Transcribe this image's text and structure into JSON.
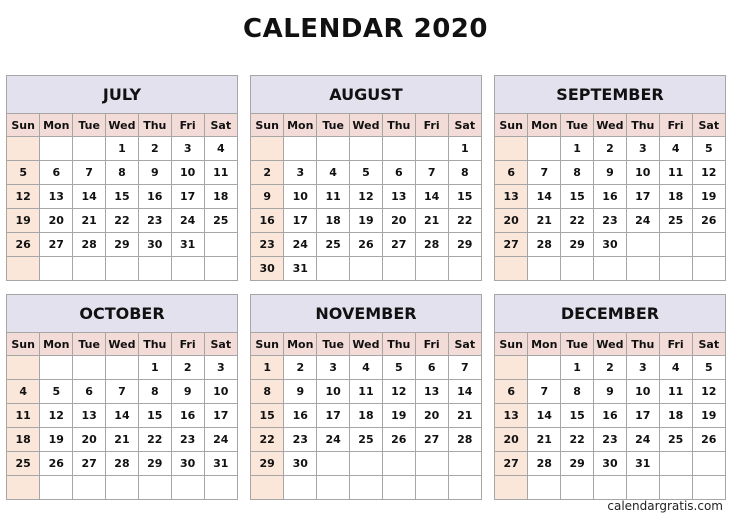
{
  "title": "CALENDAR 2020",
  "weekdays": [
    "Sun",
    "Mon",
    "Tue",
    "Wed",
    "Thu",
    "Fri",
    "Sat"
  ],
  "months": [
    {
      "name": "JULY",
      "weeks": [
        [
          "",
          "",
          "",
          "1",
          "2",
          "3",
          "4"
        ],
        [
          "5",
          "6",
          "7",
          "8",
          "9",
          "10",
          "11"
        ],
        [
          "12",
          "13",
          "14",
          "15",
          "16",
          "17",
          "18"
        ],
        [
          "19",
          "20",
          "21",
          "22",
          "23",
          "24",
          "25"
        ],
        [
          "26",
          "27",
          "28",
          "29",
          "30",
          "31",
          ""
        ],
        [
          "",
          "",
          "",
          "",
          "",
          "",
          ""
        ]
      ]
    },
    {
      "name": "AUGUST",
      "weeks": [
        [
          "",
          "",
          "",
          "",
          "",
          "",
          "1"
        ],
        [
          "2",
          "3",
          "4",
          "5",
          "6",
          "7",
          "8"
        ],
        [
          "9",
          "10",
          "11",
          "12",
          "13",
          "14",
          "15"
        ],
        [
          "16",
          "17",
          "18",
          "19",
          "20",
          "21",
          "22"
        ],
        [
          "23",
          "24",
          "25",
          "26",
          "27",
          "28",
          "29"
        ],
        [
          "30",
          "31",
          "",
          "",
          "",
          "",
          ""
        ]
      ]
    },
    {
      "name": "SEPTEMBER",
      "weeks": [
        [
          "",
          "",
          "1",
          "2",
          "3",
          "4",
          "5"
        ],
        [
          "6",
          "7",
          "8",
          "9",
          "10",
          "11",
          "12"
        ],
        [
          "13",
          "14",
          "15",
          "16",
          "17",
          "18",
          "19"
        ],
        [
          "20",
          "21",
          "22",
          "23",
          "24",
          "25",
          "26"
        ],
        [
          "27",
          "28",
          "29",
          "30",
          "",
          "",
          ""
        ],
        [
          "",
          "",
          "",
          "",
          "",
          "",
          ""
        ]
      ]
    },
    {
      "name": "OCTOBER",
      "weeks": [
        [
          "",
          "",
          "",
          "",
          "1",
          "2",
          "3"
        ],
        [
          "4",
          "5",
          "6",
          "7",
          "8",
          "9",
          "10"
        ],
        [
          "11",
          "12",
          "13",
          "14",
          "15",
          "16",
          "17"
        ],
        [
          "18",
          "19",
          "20",
          "21",
          "22",
          "23",
          "24"
        ],
        [
          "25",
          "26",
          "27",
          "28",
          "29",
          "30",
          "31"
        ],
        [
          "",
          "",
          "",
          "",
          "",
          "",
          ""
        ]
      ]
    },
    {
      "name": "NOVEMBER",
      "weeks": [
        [
          "1",
          "2",
          "3",
          "4",
          "5",
          "6",
          "7"
        ],
        [
          "8",
          "9",
          "10",
          "11",
          "12",
          "13",
          "14"
        ],
        [
          "15",
          "16",
          "17",
          "18",
          "19",
          "20",
          "21"
        ],
        [
          "22",
          "23",
          "24",
          "25",
          "26",
          "27",
          "28"
        ],
        [
          "29",
          "30",
          "",
          "",
          "",
          "",
          ""
        ],
        [
          "",
          "",
          "",
          "",
          "",
          "",
          ""
        ]
      ]
    },
    {
      "name": "DECEMBER",
      "weeks": [
        [
          "",
          "",
          "1",
          "2",
          "3",
          "4",
          "5"
        ],
        [
          "6",
          "7",
          "8",
          "9",
          "10",
          "11",
          "12"
        ],
        [
          "13",
          "14",
          "15",
          "16",
          "17",
          "18",
          "19"
        ],
        [
          "20",
          "21",
          "22",
          "23",
          "24",
          "25",
          "26"
        ],
        [
          "27",
          "28",
          "29",
          "30",
          "31",
          "",
          ""
        ],
        [
          "",
          "",
          "",
          "",
          "",
          "",
          ""
        ]
      ]
    }
  ],
  "footer": "calendargratis.com"
}
